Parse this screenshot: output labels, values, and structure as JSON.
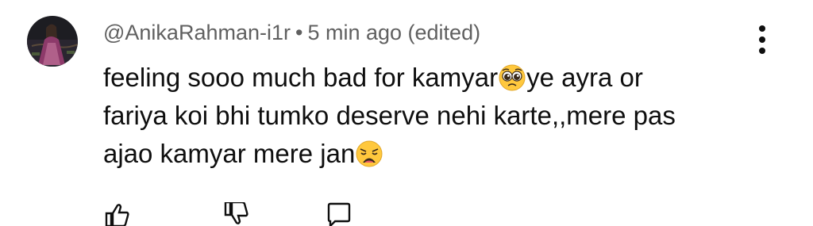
{
  "comment": {
    "author": "@AnikaRahman-i1r",
    "separator": "•",
    "timestamp": "5 min ago (edited)",
    "text_lines": [
      "feeling sooo much bad for kamyar",
      "ye ayra or",
      "fariya koi bhi tumko deserve nehi karte,,mere pas",
      "ajao kamyar mere jan"
    ],
    "emojis": [
      "pleading-face",
      "weary-face"
    ]
  },
  "actions": [
    "like-icon",
    "dislike-icon",
    "reply-icon"
  ],
  "colors": {
    "meta_text": "#606060",
    "body_text": "#0f0f0f",
    "emoji_yellow": "#FFC83D"
  }
}
